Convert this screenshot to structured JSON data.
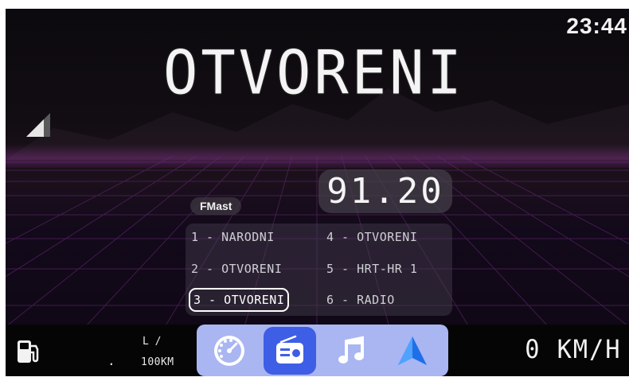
{
  "header": {
    "clock": "23:44"
  },
  "radio": {
    "station_name": "OTVORENI",
    "rds_label": "FMast",
    "frequency": "91.20",
    "presets": [
      {
        "label": "1 - NARODNI"
      },
      {
        "label": "2 - OTVORENI"
      },
      {
        "label": "3 - OTVORENI",
        "selected": true
      },
      {
        "label": "4 - OTVORENI"
      },
      {
        "label": "5 - HRT-HR 1"
      },
      {
        "label": "6 - RADIO"
      }
    ]
  },
  "status": {
    "fuel_unit": "L /",
    "fuel_value": ".",
    "fuel_per": "100KM",
    "speed": "0 KM/H"
  },
  "dock": {
    "apps": [
      {
        "icon": "speedometer-icon"
      },
      {
        "icon": "radio-icon",
        "active": true
      },
      {
        "icon": "music-note-icon"
      },
      {
        "icon": "navigation-arrow-icon"
      }
    ]
  },
  "colors": {
    "dock_background": "#a9b6f2",
    "dock_active": "#3f5ee6",
    "text": "#f4f4f4"
  }
}
